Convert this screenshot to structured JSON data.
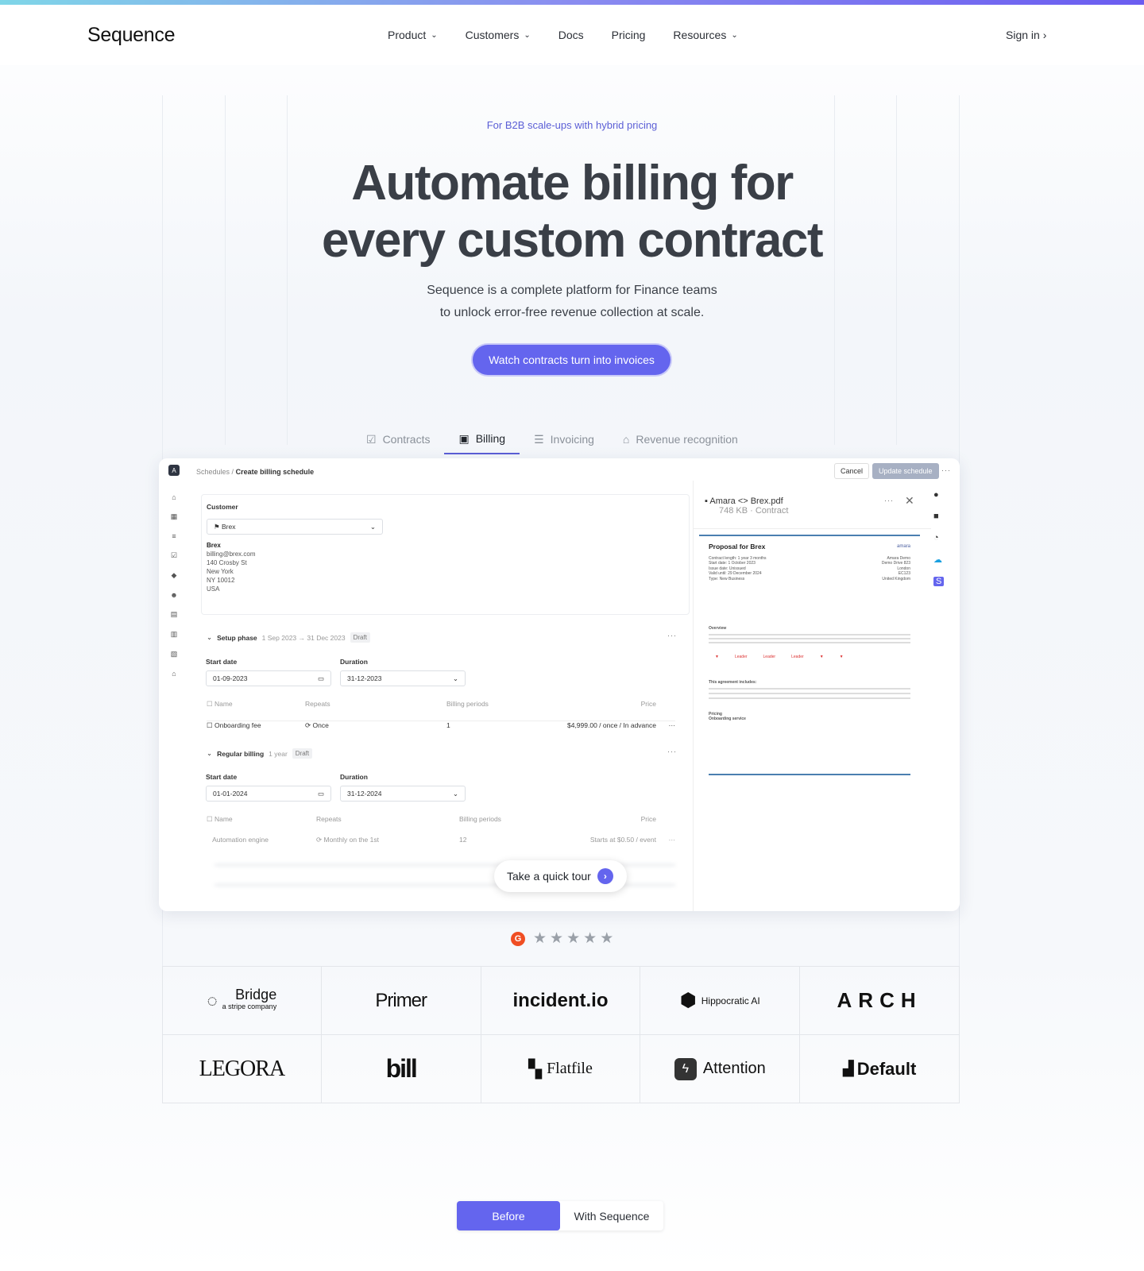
{
  "nav": {
    "logo": "Sequence",
    "items": [
      {
        "label": "Product",
        "dropdown": true
      },
      {
        "label": "Customers",
        "dropdown": true
      },
      {
        "label": "Docs"
      },
      {
        "label": "Pricing"
      },
      {
        "label": "Resources",
        "dropdown": true
      }
    ],
    "signin": "Sign in"
  },
  "hero": {
    "eyebrow": "For B2B scale-ups with hybrid pricing",
    "title_line1": "Automate billing for",
    "title_line2": "every custom contract",
    "sub_line1": "Sequence is a complete platform for Finance teams",
    "sub_line2": "to unlock error-free revenue collection at scale.",
    "cta": "Watch contracts turn into invoices"
  },
  "tabs": [
    {
      "label": "Contracts",
      "icon": "contract-icon"
    },
    {
      "label": "Billing",
      "icon": "calendar-icon",
      "active": true
    },
    {
      "label": "Invoicing",
      "icon": "invoice-stack-icon"
    },
    {
      "label": "Revenue recognition",
      "icon": "bank-icon"
    }
  ],
  "app": {
    "avatar": "A",
    "breadcrumb_parent": "Schedules",
    "breadcrumb_sep": "/",
    "breadcrumb_current": "Create billing schedule",
    "cancel": "Cancel",
    "update": "Update schedule",
    "customer": {
      "label": "Customer",
      "selected": "Brex",
      "name": "Brex",
      "email": "billing@brex.com",
      "address": [
        "140 Crosby St",
        "New York",
        "NY 10012",
        "USA"
      ]
    },
    "setup": {
      "title": "Setup phase",
      "range": "1 Sep 2023 → 31 Dec 2023",
      "status": "Draft",
      "start_label": "Start date",
      "start": "01-09-2023",
      "duration_label": "Duration",
      "duration": "31-12-2023",
      "columns": [
        "Name",
        "Repeats",
        "Billing periods",
        "Price"
      ],
      "rows": [
        {
          "name": "Onboarding fee",
          "repeats": "Once",
          "periods": "1",
          "price": "$4,999.00 / once / In advance"
        }
      ]
    },
    "regular": {
      "title": "Regular billing",
      "range": "1 year",
      "status": "Draft",
      "start_label": "Start date",
      "start": "01-01-2024",
      "duration_label": "Duration",
      "duration": "31-12-2024",
      "columns": [
        "Name",
        "Repeats",
        "Billing periods",
        "Price"
      ],
      "rows": [
        {
          "name": "Automation engine",
          "repeats": "Monthly on the 1st",
          "periods": "12",
          "price": "Starts at $0.50 / event"
        }
      ]
    },
    "doc": {
      "name": "Amara <> Brex.pdf",
      "meta": "748 KB · Contract",
      "title": "Proposal for Brex",
      "brand": "amara",
      "details": [
        "Contract length: 1 year 3 months",
        "Start date: 1 October 2023",
        "Issue date: Unissued",
        "Valid until: 29 December 2024",
        "Type: New Business"
      ],
      "address": [
        "Amara Demo",
        "Demo Drive 823",
        "London",
        "EC123",
        "United Kingdom"
      ],
      "overview": "Overview",
      "includes": "This agreement includes:",
      "pricing": "Pricing",
      "service": "Onboarding service",
      "badges": [
        "Leader",
        "Leader",
        "Leader"
      ]
    }
  },
  "tour": "Take a quick tour",
  "logos": [
    "Bridge",
    "Primer",
    "incident.io",
    "Hippocratic AI",
    "ARCH",
    "LEGORA",
    "bill",
    "Flatfile",
    "Attention",
    "Default"
  ],
  "bridge_tag": "a stripe company",
  "rating": {
    "brand": "G",
    "stars": 5
  },
  "toggle": {
    "before": "Before",
    "after": "With Sequence"
  },
  "colors": {
    "accent": "#6465ee",
    "text": "#3a3f47"
  }
}
